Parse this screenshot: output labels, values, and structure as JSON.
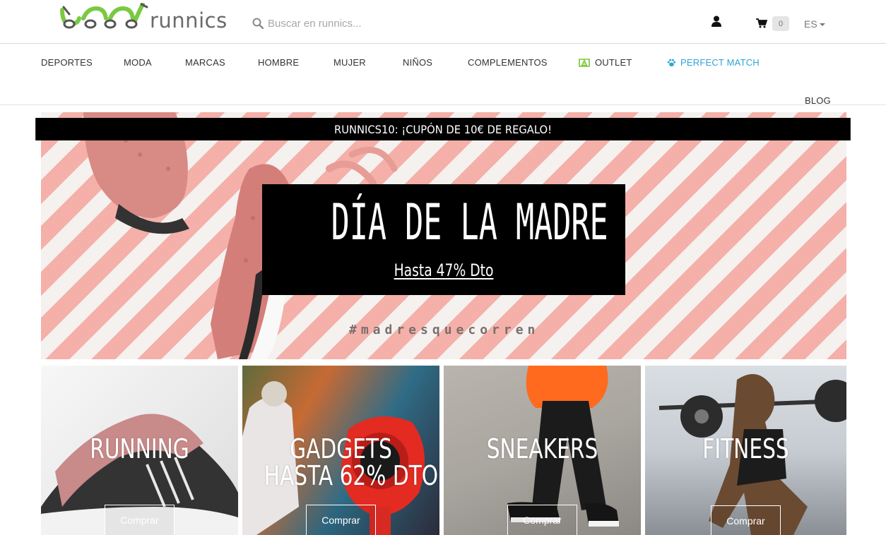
{
  "header": {
    "logo_text": "runnics",
    "search_placeholder": "Buscar en runnics...",
    "cart_count": "0",
    "language": "ES",
    "accent_green": "#78c531",
    "accent_blue": "#2fa3d6"
  },
  "nav": {
    "items": [
      {
        "label": "DEPORTES"
      },
      {
        "label": "MODA"
      },
      {
        "label": "MARCAS"
      },
      {
        "label": "HOMBRE"
      },
      {
        "label": "MUJER"
      },
      {
        "label": "NIÑOS"
      },
      {
        "label": "COMPLEMENTOS"
      },
      {
        "label": "OUTLET",
        "icon": "outlet-icon"
      },
      {
        "label": "PERFECT MATCH",
        "icon": "paw-icon"
      },
      {
        "label": "BLOG"
      }
    ]
  },
  "promo_bar": {
    "text": "RUNNICS10: ¡CUPÓN DE 10€ DE REGALO!"
  },
  "hero": {
    "title": "DÍA DE LA MADRE",
    "subtitle": "Hasta 47% Dto",
    "hashtag": "#madresquecorren"
  },
  "tiles": [
    {
      "title": "RUNNING",
      "button": "Comprar"
    },
    {
      "title_line1": "GADGETS",
      "title_line2": "HASTA 62% DTO",
      "button": "Comprar"
    },
    {
      "title": "SNEAKERS",
      "button": "Comprar"
    },
    {
      "title": "FITNESS",
      "button": "Comprar"
    }
  ]
}
